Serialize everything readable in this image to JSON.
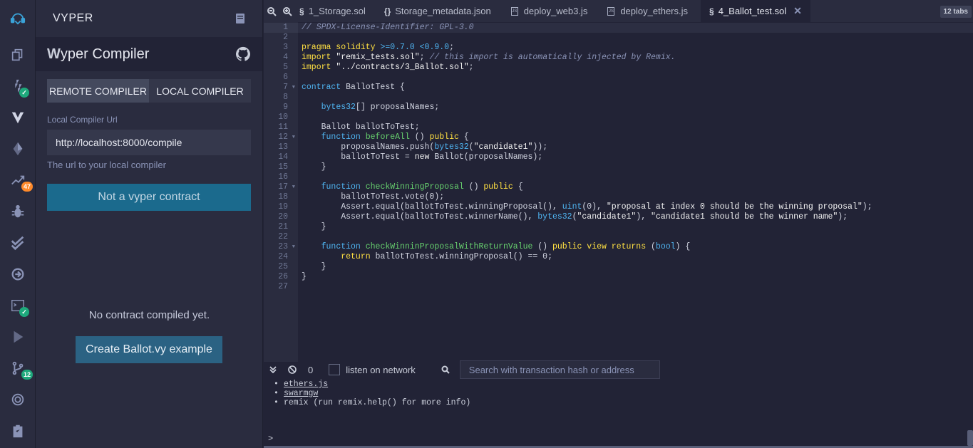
{
  "panel": {
    "title": "VYPER",
    "plugin_title": "yper Compiler",
    "plugin_title_initial": "W"
  },
  "compiler_tabs": {
    "remote": "REMOTE COMPILER",
    "local": "LOCAL COMPILER",
    "active": "remote"
  },
  "local_url": {
    "label": "Local Compiler Url",
    "value": "http://localhost:8000/compile",
    "hint": "The url to your local compiler"
  },
  "status_button": "Not a vyper contract",
  "no_contract_text": "No contract compiled yet.",
  "create_button": "Create Ballot.vy example",
  "rail": {
    "icons": [
      "remix-logo-icon",
      "files-icon",
      "solidity-compiler-icon",
      "vyper-icon",
      "deploy-icon",
      "analysis-icon",
      "debugger-icon",
      "unit-test-icon",
      "plugin-manager-icon",
      "terminal-plugin-icon",
      "run-icon",
      "git-icon",
      "settings-icon",
      "clipboard-icon"
    ],
    "analysis_badge": "47",
    "git_badge": "12"
  },
  "tabs": {
    "items": [
      {
        "label": "1_Storage.sol",
        "icon": "solidity"
      },
      {
        "label": "Storage_metadata.json",
        "icon": "json"
      },
      {
        "label": "deploy_web3.js",
        "icon": "js"
      },
      {
        "label": "deploy_ethers.js",
        "icon": "js"
      },
      {
        "label": "4_Ballot_test.sol",
        "icon": "solidity",
        "active": true
      }
    ],
    "count_label": "12 tabs"
  },
  "code": {
    "line_numbers": [
      "1",
      "2",
      "3",
      "4",
      "5",
      "6",
      "7",
      "8",
      "9",
      "10",
      "11",
      "12",
      "13",
      "14",
      "15",
      "16",
      "17",
      "18",
      "19",
      "20",
      "21",
      "22",
      "23",
      "24",
      "25",
      "26",
      "27"
    ],
    "foldable": [
      7,
      12,
      17,
      23
    ],
    "active_line": 1
  },
  "terminal": {
    "tx_count": "0",
    "listen_label": "listen on network",
    "search_placeholder": "Search with transaction hash or address",
    "lines": [
      {
        "text": "ethers.js",
        "link": true
      },
      {
        "text": "swarmgw",
        "link": true
      },
      {
        "text": "remix (run remix.help() for more info)",
        "link": false
      }
    ],
    "prompt": ">"
  },
  "colors": {
    "bg": "#222336",
    "panel": "#2a2c3f",
    "accent_button": "#1b6a8d",
    "keyword": "#ffe042",
    "type": "#4fb4f1",
    "function": "#67d16e",
    "badge_green": "#1ea97c",
    "badge_orange": "#ff8a2a"
  }
}
